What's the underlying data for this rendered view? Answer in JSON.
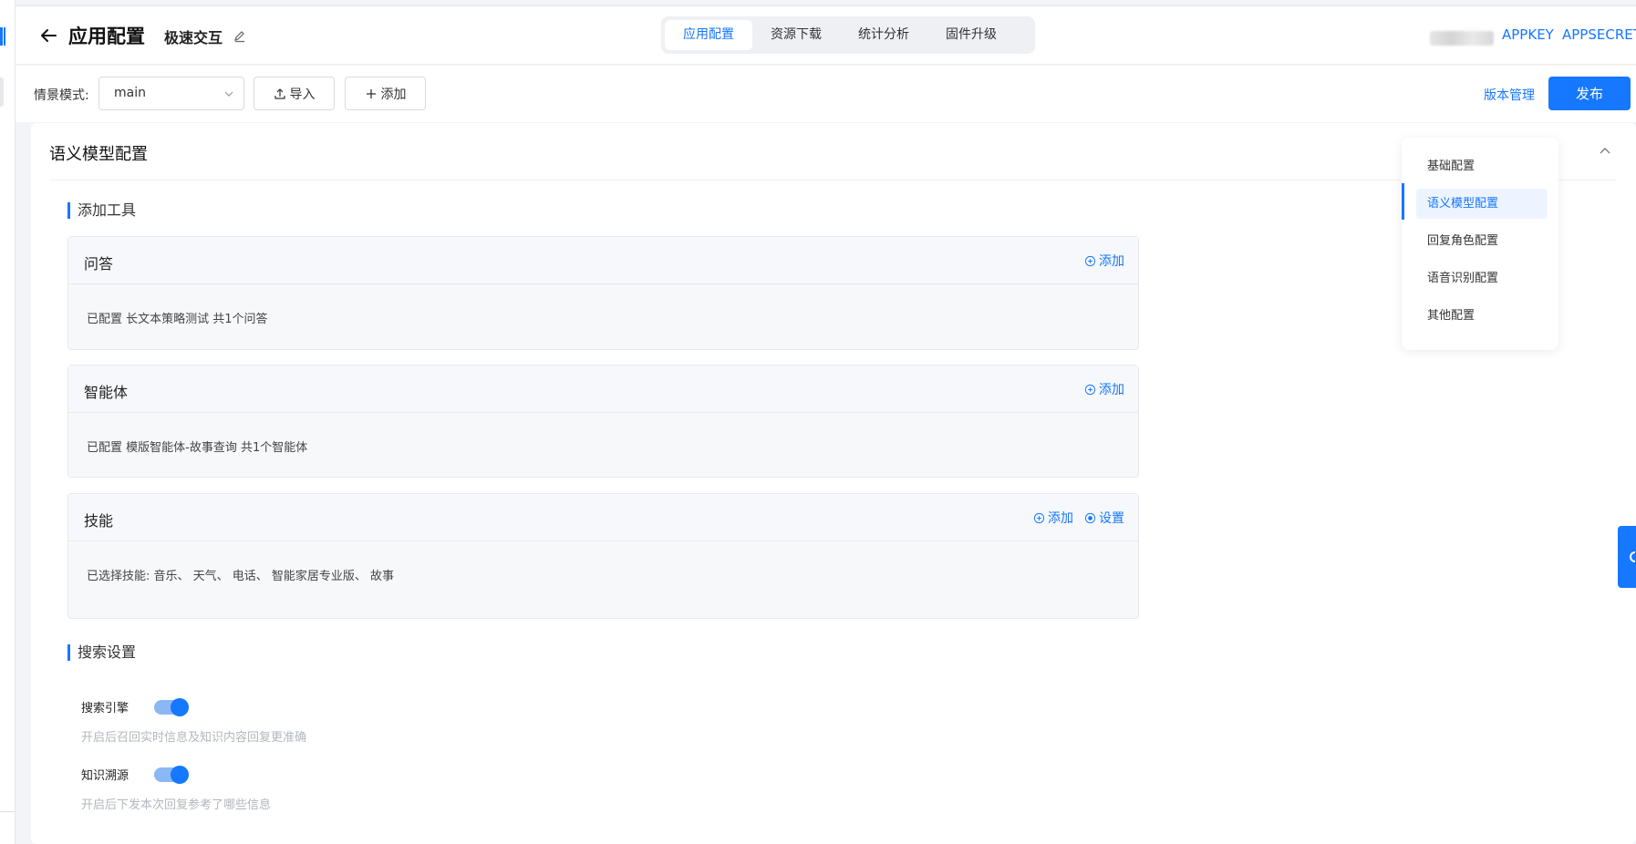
{
  "header": {
    "title": "应用配置",
    "app_name": "极速交互",
    "tabs": [
      {
        "label": "应用配置",
        "active": true
      },
      {
        "label": "资源下载",
        "active": false
      },
      {
        "label": "统计分析",
        "active": false
      },
      {
        "label": "固件升级",
        "active": false
      }
    ],
    "appkey_label": "APPKEY",
    "appsecret_label": "APPSECRET"
  },
  "toolbar": {
    "mode_label": "情景模式:",
    "mode_value": "main",
    "import_label": "导入",
    "add_label": "添加",
    "version_label": "版本管理",
    "publish_label": "发布"
  },
  "card": {
    "title": "语义模型配置",
    "tools_section": "添加工具",
    "tools": [
      {
        "title": "问答",
        "actions": [
          "添加"
        ],
        "body": "已配置 长文本策略测试 共1个问答"
      },
      {
        "title": "智能体",
        "actions": [
          "添加"
        ],
        "body": "已配置 模版智能体-故事查询 共1个智能体"
      },
      {
        "title": "技能",
        "actions": [
          "添加",
          "设置"
        ],
        "body": "已选择技能:  音乐、 天气、 电话、 智能家居专业版、 故事"
      }
    ],
    "search_section": "搜索设置",
    "toggles": [
      {
        "label": "搜索引擎",
        "on": true,
        "hint": "开启后召回实时信息及知识内容回复更准确"
      },
      {
        "label": "知识溯源",
        "on": true,
        "hint": "开启后下发本次回复参考了哪些信息"
      }
    ]
  },
  "anchor_nav": {
    "items": [
      {
        "label": "基础配置",
        "active": false
      },
      {
        "label": "语义模型配置",
        "active": true
      },
      {
        "label": "回复角色配置",
        "active": false
      },
      {
        "label": "语音识别配置",
        "active": false
      },
      {
        "label": "其他配置",
        "active": false
      }
    ]
  },
  "colors": {
    "accent": "#1677ff"
  }
}
